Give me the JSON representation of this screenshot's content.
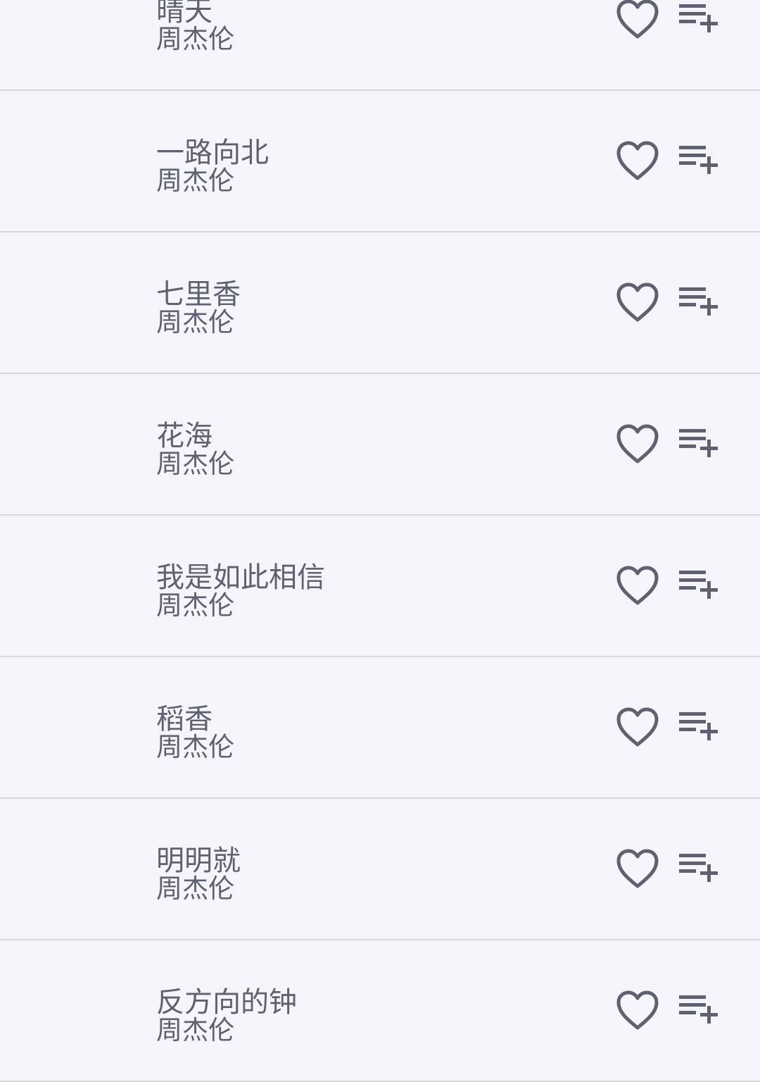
{
  "songs": [
    {
      "title": "晴天",
      "artist": "周杰伦"
    },
    {
      "title": "一路向北",
      "artist": "周杰伦"
    },
    {
      "title": "七里香",
      "artist": "周杰伦"
    },
    {
      "title": "花海",
      "artist": "周杰伦"
    },
    {
      "title": "我是如此相信",
      "artist": "周杰伦"
    },
    {
      "title": "稻香",
      "artist": "周杰伦"
    },
    {
      "title": "明明就",
      "artist": "周杰伦"
    },
    {
      "title": "反方向的钟",
      "artist": "周杰伦"
    }
  ],
  "icons": {
    "like": "heart-outline-icon",
    "add": "playlist-add-icon"
  },
  "colors": {
    "background": "#f4f5fa",
    "text": "#5d6170",
    "icon": "#5d6170",
    "divider": "#d5d8e2"
  }
}
